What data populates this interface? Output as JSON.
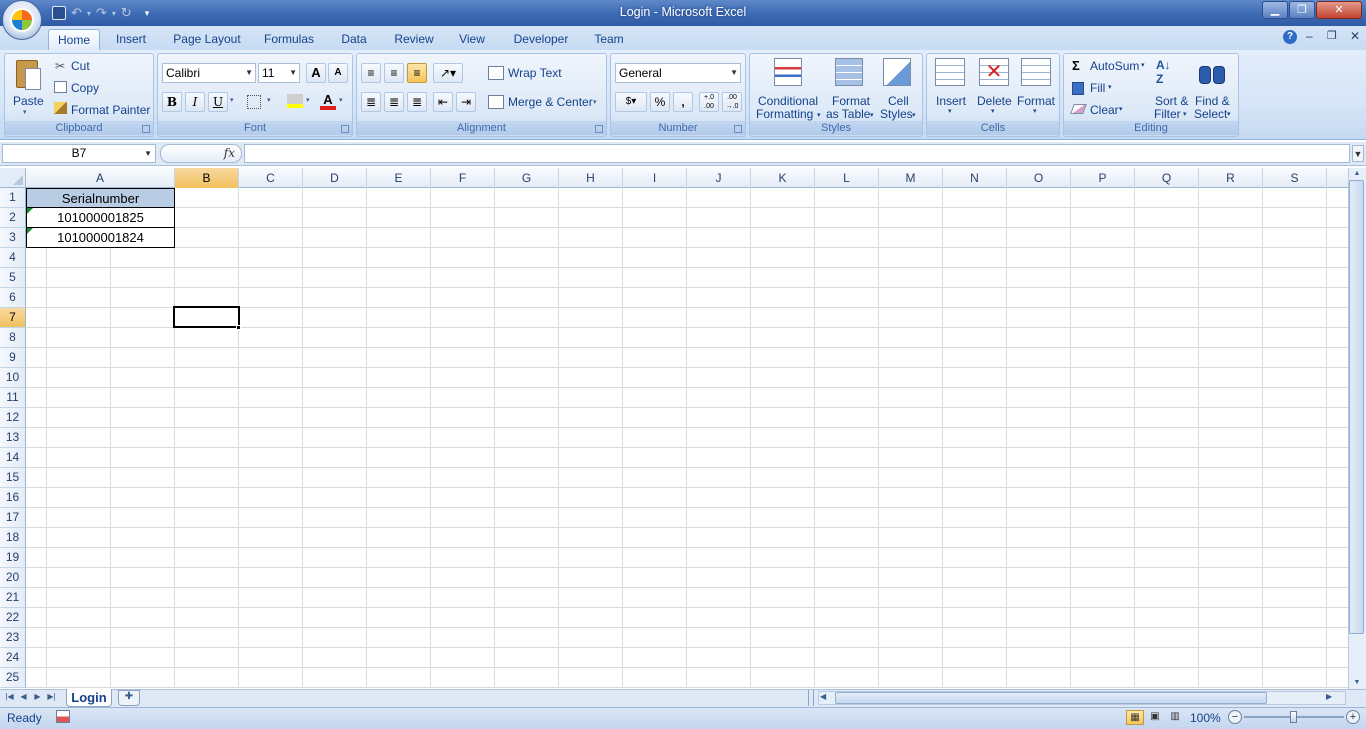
{
  "window": {
    "title": "Login - Microsoft Excel"
  },
  "ribbon_tabs": [
    "Home",
    "Insert",
    "Page Layout",
    "Formulas",
    "Data",
    "Review",
    "View",
    "Developer",
    "Team"
  ],
  "clipboard": {
    "paste": "Paste",
    "cut": "Cut",
    "copy": "Copy",
    "format_painter": "Format Painter",
    "label": "Clipboard"
  },
  "font": {
    "name": "Calibri",
    "size": "11",
    "bold": "B",
    "italic": "I",
    "underline": "U",
    "grow": "A",
    "shrink": "A",
    "color_letter": "A",
    "label": "Font"
  },
  "alignment": {
    "wrap_text": "Wrap Text",
    "merge_center": "Merge & Center",
    "label": "Alignment"
  },
  "number": {
    "format": "General",
    "percent": "%",
    "comma": ",",
    "inc_decimal": "+.0 .00",
    "dec_decimal": ".00 →.0",
    "label": "Number"
  },
  "styles": {
    "conditional": [
      "Conditional",
      "Formatting"
    ],
    "format_table": [
      "Format",
      "as Table"
    ],
    "cell_styles": [
      "Cell",
      "Styles"
    ],
    "label": "Styles"
  },
  "cells": {
    "insert": "Insert",
    "delete": "Delete",
    "format": "Format",
    "label": "Cells"
  },
  "editing": {
    "autosum": "AutoSum",
    "fill": "Fill",
    "clear": "Clear",
    "sort_filter": [
      "Sort &",
      "Filter"
    ],
    "find_select": [
      "Find &",
      "Select"
    ],
    "label": "Editing"
  },
  "formula_bar": {
    "name_box": "B7",
    "fx": "fx",
    "formula": ""
  },
  "columns": [
    "A",
    "B",
    "C",
    "D",
    "E",
    "F",
    "G",
    "H",
    "I",
    "J",
    "K",
    "L",
    "M",
    "N",
    "O",
    "P",
    "Q",
    "R",
    "S"
  ],
  "rows": [
    "1",
    "2",
    "3",
    "4",
    "5",
    "6",
    "7",
    "8",
    "9",
    "10",
    "11",
    "12",
    "13",
    "14",
    "15",
    "16",
    "17",
    "18",
    "19",
    "20",
    "21",
    "22",
    "23",
    "24",
    "25"
  ],
  "cells_data": {
    "A1": "Serialnumber",
    "A2": "101000001825",
    "A3": "101000001824"
  },
  "selected": {
    "column": "B",
    "row": "7"
  },
  "sheets": [
    "Login"
  ],
  "status": {
    "ready": "Ready",
    "zoom": "100%"
  },
  "colors": {
    "header_fill": "#b8cce4",
    "selection_highlight": "#f1c15f",
    "title_bar": "#3f6db6"
  }
}
